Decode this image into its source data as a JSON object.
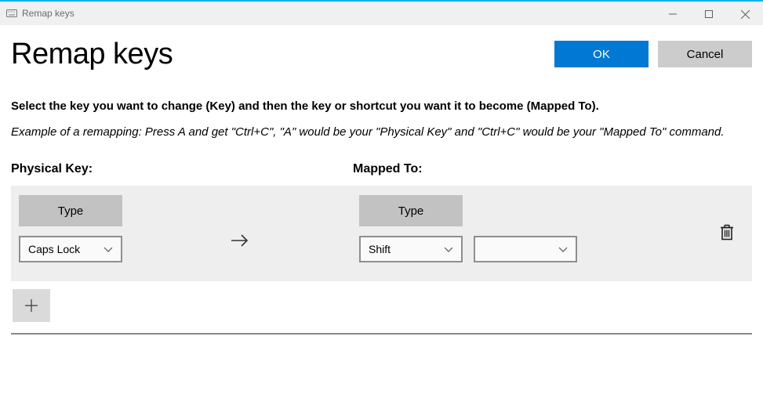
{
  "window": {
    "title": "Remap keys"
  },
  "header": {
    "title": "Remap keys",
    "ok_label": "OK",
    "cancel_label": "Cancel"
  },
  "instruction": "Select the key you want to change (Key) and then the key or shortcut you want it to become (Mapped To).",
  "example": "Example of a remapping: Press A and get \"Ctrl+C\", \"A\" would be your \"Physical Key\" and \"Ctrl+C\" would be your \"Mapped To\" command.",
  "columns": {
    "physical_label": "Physical Key:",
    "mapped_label": "Mapped To:"
  },
  "row": {
    "type_label": "Type",
    "physical_value": "Caps Lock",
    "mapped_value_1": "Shift",
    "mapped_value_2": ""
  }
}
